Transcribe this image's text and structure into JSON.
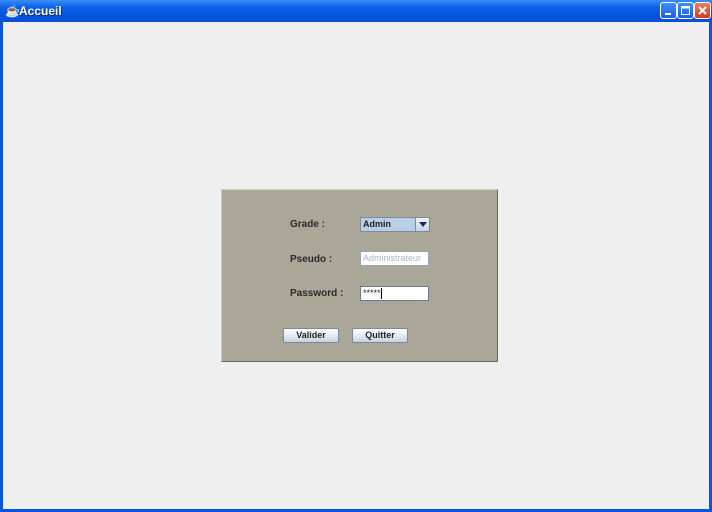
{
  "window": {
    "title": "Accueil",
    "app_icon": "java-cup-icon",
    "controls": [
      "minimize-icon",
      "maximize-icon",
      "close-icon"
    ]
  },
  "form": {
    "grade_label": "Grade :",
    "grade_value": "Admin",
    "pseudo_label": "Pseudo :",
    "pseudo_value": "Administrateur",
    "password_label": "Password :",
    "password_value": "*****",
    "valider_label": "Valider",
    "quitter_label": "Quitter"
  },
  "colors": {
    "titlebar": "#0a5fe7",
    "panel": "#aaa698",
    "background": "#efefef",
    "close_button": "#d43c1c"
  }
}
